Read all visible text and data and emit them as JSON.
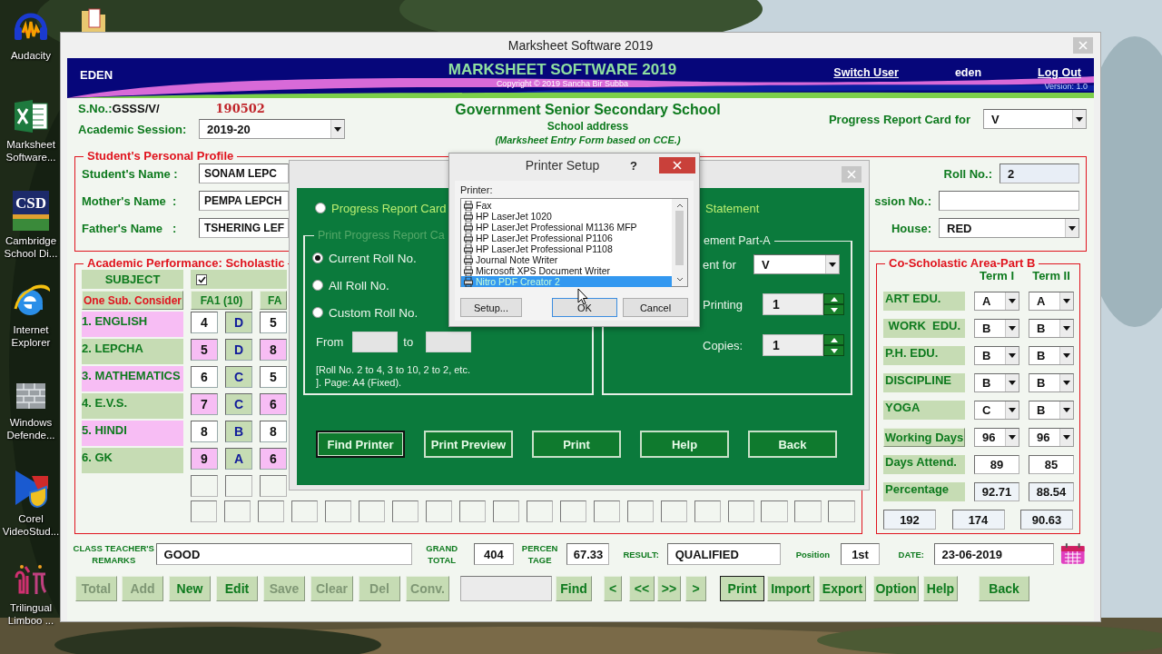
{
  "desktop": {
    "icons": [
      {
        "kind": "headphones",
        "label": "Audacity"
      },
      {
        "kind": "spreadsheet",
        "label": "Marksheet Software..."
      },
      {
        "kind": "badge",
        "badge": "CSD",
        "label": "Cambridge School Di..."
      },
      {
        "kind": "browser",
        "label": "Internet Explorer"
      },
      {
        "kind": "wall",
        "label": "Windows Defende..."
      },
      {
        "kind": "video",
        "label": "Corel VideoStud..."
      },
      {
        "kind": "glyphs",
        "label": "Trilingual Limboo ..."
      }
    ]
  },
  "main_window": {
    "title": "Marksheet Software 2019",
    "banner": {
      "user_code": "EDEN",
      "app_name": "MARKSHEET SOFTWARE 2019",
      "copyright": "Copyright © 2019 Sancha Bir Subba",
      "switch_user": "Switch User",
      "user": "eden",
      "log_out": "Log Out",
      "version": "Version: 1.0"
    },
    "header": {
      "sno_label": "S.No.:",
      "sno_prefix": "GSSS/V/",
      "sno_number": "190502",
      "session_label": "Academic Session:",
      "session": "2019-20",
      "school_name": "Government Senior Secondary School",
      "school_address": "School address",
      "form_note": "(Marksheet Entry Form  based on CCE.)",
      "report_for_label": "Progress Report Card for",
      "report_for": "V"
    },
    "profile": {
      "legend": "Student's Personal Profile",
      "fields": [
        {
          "label": "Student's Name :",
          "value": "SONAM LEPC"
        },
        {
          "label": "Mother's Name  :",
          "value": "PEMPA LEPCH"
        },
        {
          "label": "Father's Name   :",
          "value": "TSHERING LEF"
        }
      ],
      "right_fields": [
        {
          "kind": "roll",
          "label": "Roll No.:",
          "value": "2"
        },
        {
          "kind": "input",
          "label": "ssion No.:"
        },
        {
          "kind": "combo",
          "label": "House:",
          "value": "RED"
        }
      ]
    },
    "scholastic": {
      "legend": "Academic Performance: Scholastic",
      "subject_header": "SUBJECT",
      "consider_checked": true,
      "consider_button": "One Sub. Consider",
      "columns": [
        "FA1 (10)",
        "FA"
      ],
      "subjects": [
        {
          "name": "1. ENGLISH",
          "marks": [
            "4",
            "D",
            "5"
          ]
        },
        {
          "name": "2. LEPCHA",
          "marks": [
            "5",
            "D",
            "8"
          ]
        },
        {
          "name": "3. MATHEMATICS",
          "marks": [
            "6",
            "C",
            "5"
          ]
        },
        {
          "name": "4. E.V.S.",
          "marks": [
            "7",
            "C",
            "6"
          ]
        },
        {
          "name": "5. HINDI",
          "marks": [
            "8",
            "B",
            "8"
          ]
        },
        {
          "name": "6. GK",
          "marks": [
            "9",
            "A",
            "6"
          ]
        }
      ]
    },
    "co_scholastic": {
      "legend": "Co-Scholastic Area-Part B",
      "terms": [
        "Term I",
        "Term II"
      ],
      "rows": [
        {
          "kind": "combo",
          "label": "ART EDU.",
          "values": [
            "A",
            "A"
          ]
        },
        {
          "kind": "combo",
          "label": " WORK  EDU.",
          "values": [
            "B",
            "B"
          ]
        },
        {
          "kind": "combo",
          "label": "P.H. EDU.",
          "values": [
            "B",
            "B"
          ]
        },
        {
          "kind": "combo",
          "label": "DISCIPLINE",
          "values": [
            "B",
            "B"
          ]
        },
        {
          "kind": "combo",
          "label": "YOGA",
          "values": [
            "C",
            "B"
          ]
        },
        {
          "kind": "button",
          "label": "Working Days",
          "values": [
            "96",
            "96"
          ]
        },
        {
          "kind": "input",
          "label": "Days Attend.",
          "values": [
            "89",
            "85"
          ]
        },
        {
          "kind": "readonly",
          "label": "Percentage",
          "values": [
            "92.71",
            "88.54"
          ]
        }
      ],
      "totals": [
        "192",
        "174",
        "90.63"
      ]
    },
    "summary": [
      {
        "label": [
          "CLASS TEACHER'S",
          "REMARKS"
        ],
        "value": "GOOD"
      },
      {
        "label": [
          "GRAND",
          "TOTAL"
        ],
        "value": "404"
      },
      {
        "label": [
          "PERCEN",
          "TAGE"
        ],
        "value": "67.33"
      },
      {
        "label": [
          "RESULT:"
        ],
        "value": "QUALIFIED"
      },
      {
        "label": [
          "Position"
        ],
        "value": "1st"
      },
      {
        "label": [
          "DATE:"
        ],
        "value": "23-06-2019"
      }
    ],
    "buttons": [
      {
        "kind": "button",
        "label": "Total",
        "disabled": true,
        "focused": false
      },
      {
        "kind": "button",
        "label": "Add",
        "disabled": true,
        "focused": false
      },
      {
        "kind": "button",
        "label": "New",
        "disabled": false,
        "focused": false
      },
      {
        "kind": "button",
        "label": "Edit",
        "disabled": false,
        "focused": false
      },
      {
        "kind": "button",
        "label": "Save",
        "disabled": true,
        "focused": false
      },
      {
        "kind": "button",
        "label": "Clear",
        "disabled": true,
        "focused": false
      },
      {
        "kind": "button",
        "label": "Del",
        "disabled": true,
        "focused": false
      },
      {
        "kind": "button",
        "label": "Conv.",
        "disabled": true,
        "focused": false
      },
      {
        "kind": "field"
      },
      {
        "kind": "button",
        "label": "Find",
        "disabled": false,
        "focused": false
      },
      {
        "kind": "button",
        "label": "<",
        "disabled": false,
        "focused": false
      },
      {
        "kind": "button",
        "label": "<<",
        "disabled": false,
        "focused": false
      },
      {
        "kind": "button",
        "label": ">>",
        "disabled": false,
        "focused": false
      },
      {
        "kind": "button",
        "label": ">",
        "disabled": false,
        "focused": false
      },
      {
        "kind": "button",
        "label": "Print",
        "disabled": false,
        "focused": true
      },
      {
        "kind": "button",
        "label": "Import",
        "disabled": false,
        "focused": false
      },
      {
        "kind": "button",
        "label": "Export",
        "disabled": false,
        "focused": false
      },
      {
        "kind": "button",
        "label": "Option",
        "disabled": false,
        "focused": false
      },
      {
        "kind": "button",
        "label": "Help",
        "disabled": false,
        "focused": false
      },
      {
        "kind": "button",
        "label": "Back",
        "disabled": false,
        "focused": false
      }
    ]
  },
  "print_dialog": {
    "report_option": {
      "label": "Progress Report Card",
      "selected": false
    },
    "statement_label": "Statement",
    "left_group": {
      "legend": "Print Progress Report Ca",
      "roll_options": [
        {
          "label": "Current Roll No.",
          "selected": true
        },
        {
          "label": "All Roll No.",
          "selected": false
        },
        {
          "label": "Custom Roll No.",
          "selected": false
        }
      ],
      "from_label": "From",
      "to_label": "to",
      "note": "[Roll No. 2 to 4, 3 to 10, 2 to 2, etc. ]. Page: A4 (Fixed)."
    },
    "right_group": {
      "legend": "ement Part-A",
      "class_label": "ent for",
      "class_value": "V",
      "printing_label": "Printing",
      "printing_value": "1",
      "copies_label": "Copies:",
      "copies_value": "1"
    },
    "buttons": [
      {
        "label": "Find Printer",
        "focused": true
      },
      {
        "label": "Print Preview",
        "focused": false
      },
      {
        "label": "Print",
        "focused": false
      },
      {
        "label": "Help",
        "focused": false
      },
      {
        "label": "Back",
        "focused": false
      }
    ]
  },
  "printer_setup": {
    "title": "Printer Setup",
    "help": "?",
    "printer_label": "Printer:",
    "printers": [
      {
        "name": "Fax",
        "selected": false
      },
      {
        "name": "HP LaserJet 1020",
        "selected": false
      },
      {
        "name": "HP LaserJet Professional M1136 MFP",
        "selected": false
      },
      {
        "name": "HP LaserJet Professional P1106",
        "selected": false
      },
      {
        "name": "HP LaserJet Professional P1108",
        "selected": false
      },
      {
        "name": "Journal Note Writer",
        "selected": false
      },
      {
        "name": "Microsoft XPS Document Writer",
        "selected": false
      },
      {
        "name": "Nitro PDF Creator 2",
        "selected": true
      }
    ],
    "buttons": [
      {
        "label": "Setup...",
        "focused": false
      },
      {
        "label": "OK",
        "focused": true
      },
      {
        "label": "Cancel",
        "focused": false
      }
    ]
  }
}
